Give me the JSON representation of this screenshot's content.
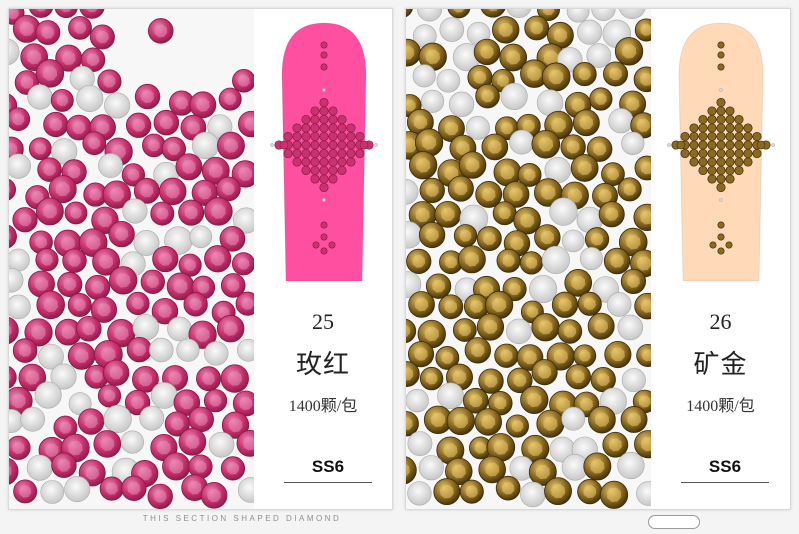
{
  "panels": [
    {
      "number": "25",
      "name": "玫红",
      "quantity": "1400颗/包",
      "size": "SS6",
      "colors": {
        "gem": "#c8326e",
        "gem_light": "#e889b4",
        "gem_dark": "#8a1848",
        "nail": "#ff4fa0"
      }
    },
    {
      "number": "26",
      "name": "矿金",
      "quantity": "1400颗/包",
      "size": "SS6",
      "colors": {
        "gem": "#8a6a22",
        "gem_light": "#e7c56a",
        "gem_dark": "#3d2c08",
        "nail": "#ffd9b8"
      }
    }
  ],
  "caption": "THIS SECTION SHAPED DIAMOND"
}
